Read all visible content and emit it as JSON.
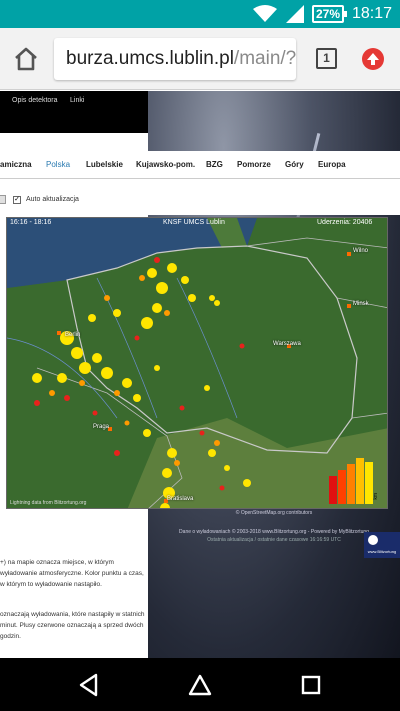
{
  "status": {
    "battery": "27%",
    "time": "18:17"
  },
  "browser": {
    "url_host": "burza.umcs.lublin.pl",
    "url_path": "/main/?",
    "tab_count": "1"
  },
  "site": {
    "topnav": [
      "Opis detektora",
      "Linki"
    ],
    "regions": [
      {
        "label": "amiczna",
        "active": false
      },
      {
        "label": "Polska",
        "active": true
      },
      {
        "label": "Lubelskie",
        "active": false
      },
      {
        "label": "Kujawsko-pom.",
        "active": false
      },
      {
        "label": "BZG",
        "active": false
      },
      {
        "label": "Pomorze",
        "active": false
      },
      {
        "label": "Góry",
        "active": false
      },
      {
        "label": "Europa",
        "active": false
      }
    ],
    "auto_update_label": "Auto aktualizacja",
    "auto_update_checked": true
  },
  "map": {
    "time_range": "16:16 - 18:16",
    "title": "KNSF UMCS Lublin",
    "strikes": "Uderzenia: 20406",
    "cities": {
      "berlin": "Berlin",
      "warszawa": "Warszawa",
      "praga": "Praga",
      "bratislava": "Bratislava",
      "wilno": "Wilno",
      "minsk": "Minsk"
    },
    "footer": "Lightning data from Blitzortung.org",
    "histogram_label": "km"
  },
  "credits": {
    "map_credit": "© OpenStreetMap.org contributors",
    "line1": "Dane o wyładowaniach © 2003-2018 www.Blitzortung.org - Powered by MyBlitzortung",
    "line2": "Ostatnia aktualizacja / ostatnie dane czasowe 16:16:59 UTC",
    "badge": "www.Blitzortung"
  },
  "description": {
    "para1": "+) na mapie oznacza miejsce, w którym wyładowanie atmosferyczne. Kolor punktu a czas, w którym to wyładowanie nastąpiło.",
    "para2": "oznaczają wyładowania, które nastąpiły w statnich minut. Plusy czerwone oznaczają a sprzed dwóch godzin."
  }
}
